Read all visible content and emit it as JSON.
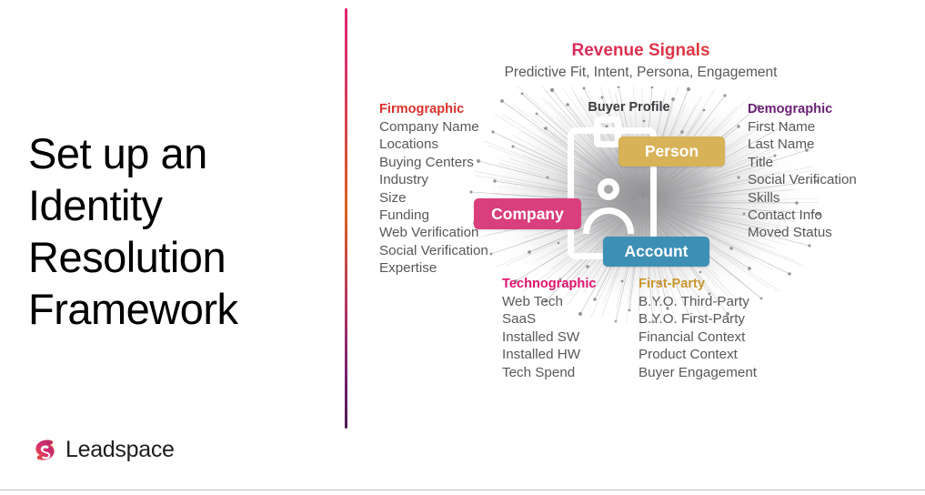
{
  "slide": {
    "title_lines": [
      "Set up an",
      "Identity",
      "Resolution",
      "Framework"
    ],
    "logo_text": "Leadspace"
  },
  "diagram": {
    "revenue_title": "Revenue Signals",
    "revenue_subtitle": "Predictive Fit, Intent, Persona, Engagement",
    "center_label": "Buyer Profile",
    "pills": [
      {
        "label": "Person",
        "color": "#d8b257"
      },
      {
        "label": "Company",
        "color": "#d93f7d"
      },
      {
        "label": "Account",
        "color": "#3d8fb5"
      }
    ],
    "columns": [
      {
        "heading": "Firmographic",
        "heading_color": "#d9322c",
        "items": [
          "Company Name",
          "Locations",
          "Buying Centers",
          "Industry",
          "Size",
          "Funding",
          "Web Verification",
          "Social Verification",
          "Expertise"
        ]
      },
      {
        "heading": "Demographic",
        "heading_color": "#6b2075",
        "items": [
          "First Name",
          "Last Name",
          "Title",
          "Social Verification",
          "Skills",
          "Contact Info",
          "Moved Status"
        ]
      },
      {
        "heading": "Technographic",
        "heading_color": "#e0146e",
        "items": [
          "Web Tech",
          "SaaS",
          "Installed SW",
          "Installed HW",
          "Tech Spend"
        ]
      },
      {
        "heading": "First-Party",
        "heading_color": "#c9962f",
        "items": [
          "B.Y.O. Third-Party",
          "B.Y.O. First-Party",
          "Financial Context",
          "Product Context",
          "Buyer Engagement"
        ]
      }
    ]
  },
  "colors": {
    "divider_top": "#e0276f",
    "divider_mid": "#d9631f",
    "divider_bottom": "#4c1a56",
    "body_text": "#58585a"
  }
}
